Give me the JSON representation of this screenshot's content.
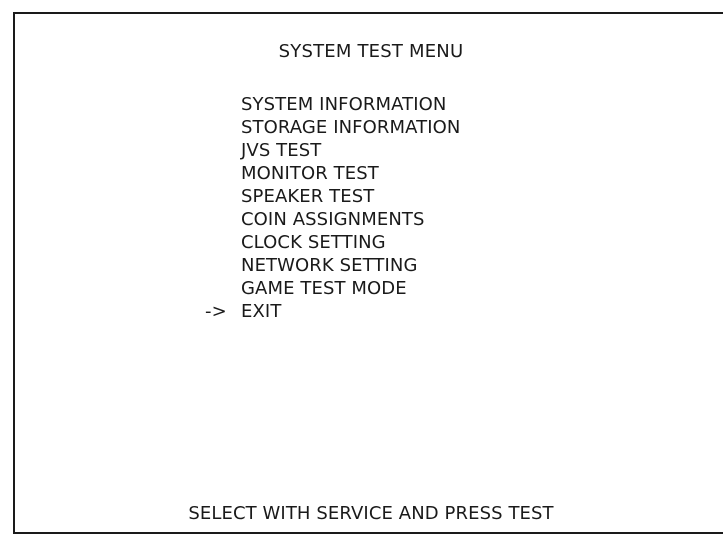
{
  "screen": {
    "title": "SYSTEM TEST MENU",
    "menu": {
      "items": [
        {
          "label": "SYSTEM INFORMATION",
          "selected": false
        },
        {
          "label": "STORAGE INFORMATION",
          "selected": false
        },
        {
          "label": "JVS TEST",
          "selected": false
        },
        {
          "label": "MONITOR TEST",
          "selected": false
        },
        {
          "label": "SPEAKER TEST",
          "selected": false
        },
        {
          "label": "COIN ASSIGNMENTS",
          "selected": false
        },
        {
          "label": "CLOCK SETTING",
          "selected": false
        },
        {
          "label": "NETWORK SETTING",
          "selected": false
        },
        {
          "label": "GAME TEST MODE",
          "selected": false
        },
        {
          "label": "EXIT",
          "selected": true
        }
      ],
      "cursor": "->"
    },
    "footer": "SELECT WITH SERVICE AND PRESS TEST"
  }
}
